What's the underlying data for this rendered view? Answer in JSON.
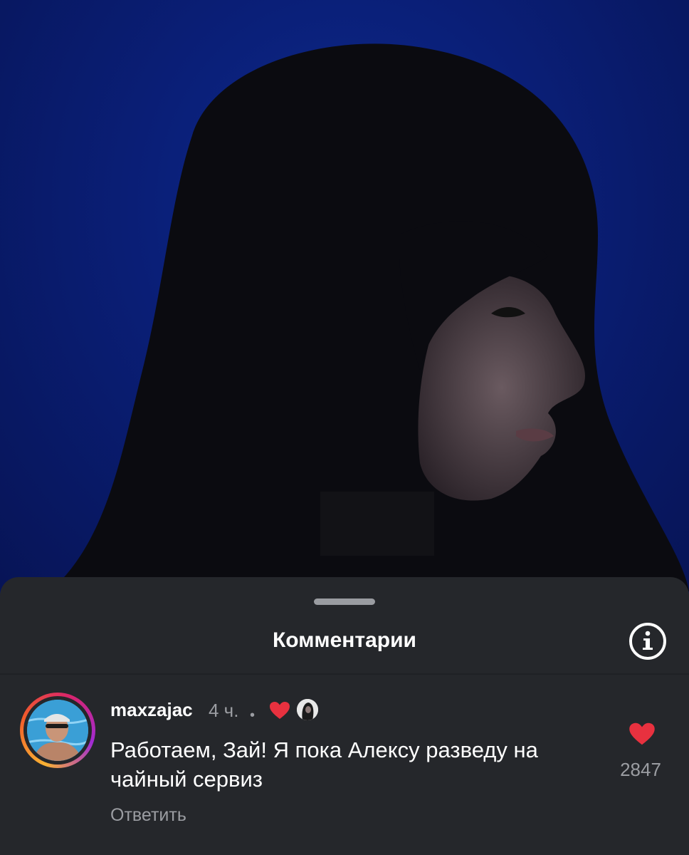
{
  "sheet": {
    "title": "Комментарии"
  },
  "comment": {
    "username": "maxzajac",
    "time": "4 ч.",
    "separator": "•",
    "text": "Работаем, Зай! Я пока Алексу разведу на чайный сервиз",
    "reply_label": "Ответить",
    "like_count": "2847"
  },
  "colors": {
    "sheet_bg": "#25272b",
    "heart": "#e8313f",
    "secondary_text": "#9b9da2",
    "photo_bg": "#0a1f78"
  },
  "icons": {
    "info": "info-icon",
    "heart": "heart-icon"
  }
}
